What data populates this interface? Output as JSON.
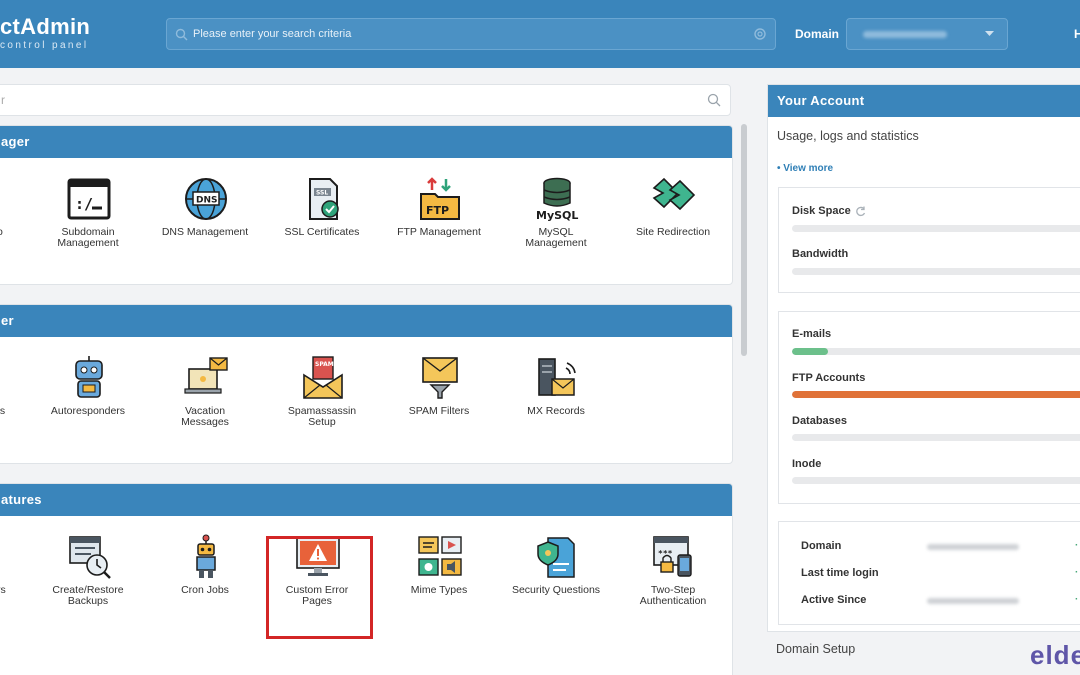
{
  "header": {
    "logo_main": "ctAdmin",
    "logo_sub": "control panel",
    "search_placeholder": "Please enter your search criteria",
    "domain_label": "Domain",
    "right_edge_text": "H"
  },
  "filter": {
    "placeholder": "r"
  },
  "sections": [
    {
      "title": "ager",
      "items": [
        {
          "label": [
            "o"
          ],
          "icon": "partial-icon"
        },
        {
          "label": [
            "Subdomain",
            "Management"
          ],
          "icon": "subdomain-icon"
        },
        {
          "label": [
            "DNS Management"
          ],
          "icon": "dns-globe-icon"
        },
        {
          "label": [
            "SSL Certificates"
          ],
          "icon": "ssl-certificate-icon"
        },
        {
          "label": [
            "FTP Management"
          ],
          "icon": "ftp-folder-icon"
        },
        {
          "label": [
            "MySQL",
            "Management"
          ],
          "icon": "mysql-database-icon"
        },
        {
          "label": [
            "Site Redirection"
          ],
          "icon": "site-redirection-icon"
        }
      ]
    },
    {
      "title": "er",
      "items": [
        {
          "label": [
            "ts"
          ],
          "icon": "partial-icon"
        },
        {
          "label": [
            "Autoresponders"
          ],
          "icon": "robot-icon"
        },
        {
          "label": [
            "Vacation",
            "Messages"
          ],
          "icon": "vacation-laptop-icon"
        },
        {
          "label": [
            "Spamassassin",
            "Setup"
          ],
          "icon": "spam-envelope-icon"
        },
        {
          "label": [
            "SPAM Filters"
          ],
          "icon": "spam-filter-icon"
        },
        {
          "label": [
            "MX Records"
          ],
          "icon": "mx-server-icon"
        }
      ]
    },
    {
      "title": "atures",
      "items": [
        {
          "label": [
            "rs"
          ],
          "icon": "partial-icon"
        },
        {
          "label": [
            "Create/Restore",
            "Backups"
          ],
          "icon": "backup-icon"
        },
        {
          "label": [
            "Cron Jobs"
          ],
          "icon": "cron-robot-icon"
        },
        {
          "label": [
            "Custom Error",
            "Pages"
          ],
          "icon": "warning-monitor-icon"
        },
        {
          "label": [
            "Mime Types"
          ],
          "icon": "mime-media-icon"
        },
        {
          "label": [
            "Security Questions"
          ],
          "icon": "security-shield-icon"
        },
        {
          "label": [
            "Two-Step",
            "Authentication"
          ],
          "icon": "two-step-auth-icon"
        }
      ]
    }
  ],
  "account": {
    "title": "Your Account",
    "subtitle": "Usage, logs and statistics",
    "view_more": "• View more",
    "stats_group1": [
      {
        "label": "Disk Space",
        "fraction": 0,
        "color": "#e8e9eb"
      },
      {
        "label": "Bandwidth",
        "fraction": 0,
        "color": "#e8e9eb"
      }
    ],
    "stats_group2": [
      {
        "label": "E-mails",
        "fraction": 0.12,
        "color": "#6cc08b"
      },
      {
        "label": "FTP Accounts",
        "fraction": 1.0,
        "color": "#e07238"
      },
      {
        "label": "Databases",
        "fraction": 0,
        "color": "#e8e9eb"
      },
      {
        "label": "Inode",
        "fraction": 0,
        "color": "#e8e9eb"
      }
    ],
    "info": [
      {
        "label": "Domain",
        "dot": "·"
      },
      {
        "label": "Last time login",
        "dot": "· V"
      },
      {
        "label": "Active Since",
        "dot": "· E"
      }
    ],
    "domain_setup": "Domain Setup"
  },
  "brand": "elde"
}
